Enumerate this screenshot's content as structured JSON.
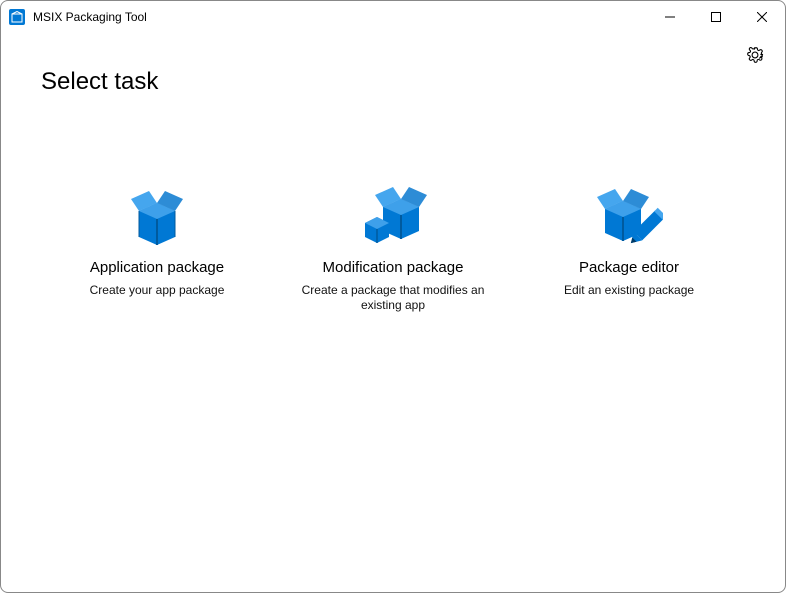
{
  "window": {
    "title": "MSIX Packaging Tool"
  },
  "page": {
    "heading": "Select task"
  },
  "tasks": [
    {
      "title": "Application package",
      "desc": "Create your app package"
    },
    {
      "title": "Modification package",
      "desc": "Create a package that modifies an existing app"
    },
    {
      "title": "Package editor",
      "desc": "Edit an existing package"
    }
  ],
  "accent": "#0078d4"
}
